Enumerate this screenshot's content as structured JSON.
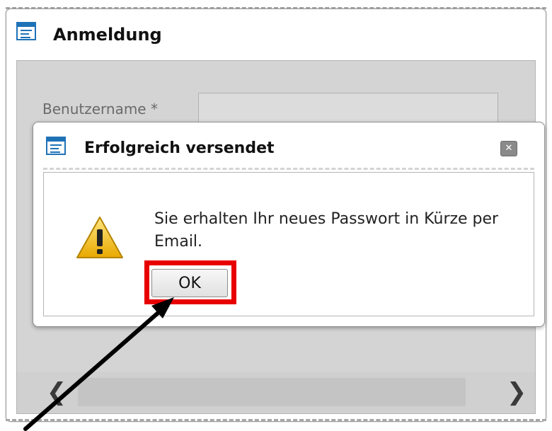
{
  "outer_window": {
    "title": "Anmeldung",
    "field_label": "Benutzername *",
    "scroll_left": "❮",
    "scroll_right": "❯"
  },
  "dialog": {
    "title": "Erfolgreich versendet",
    "close_glyph": "✕",
    "message": "Sie erhalten Ihr neues Passwort in Kürze per Email.",
    "ok_label": "OK"
  },
  "icons": {
    "window": "window-icon",
    "warning": "warning-triangle-icon",
    "close": "close-icon",
    "pointer": "arrow-pointer-icon"
  },
  "colors": {
    "accent_blue": "#1e72b8",
    "highlight_red": "#e80000",
    "warning_yellow": "#f2c200"
  }
}
